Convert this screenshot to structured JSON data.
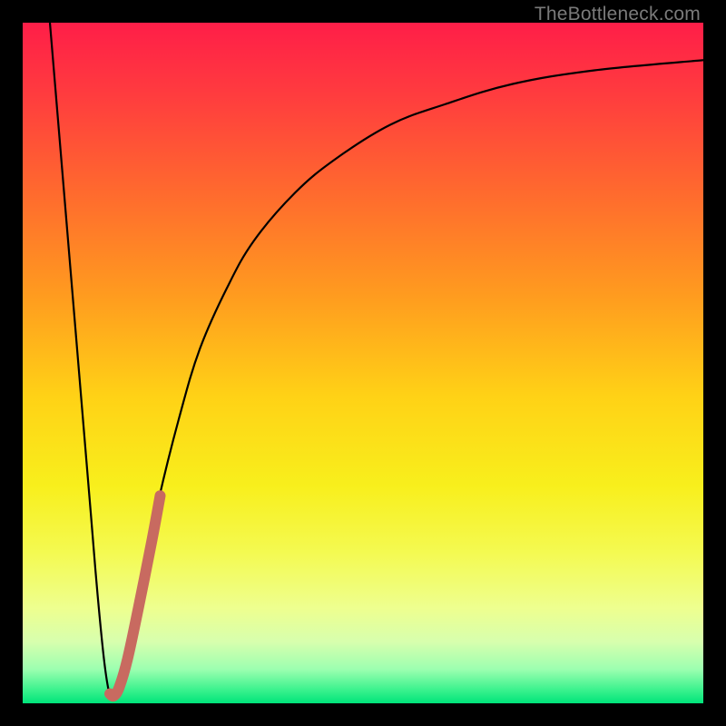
{
  "watermark": "TheBottleneck.com",
  "chart_data": {
    "type": "line",
    "title": "",
    "xlabel": "",
    "ylabel": "",
    "xlim": [
      0,
      100
    ],
    "ylim": [
      0,
      100
    ],
    "grid": false,
    "legend": false,
    "background_gradient": {
      "stops": [
        {
          "offset": 0.0,
          "color": "#ff1e48"
        },
        {
          "offset": 0.1,
          "color": "#ff3a3f"
        },
        {
          "offset": 0.25,
          "color": "#ff6a2e"
        },
        {
          "offset": 0.4,
          "color": "#ff9b1f"
        },
        {
          "offset": 0.55,
          "color": "#ffd216"
        },
        {
          "offset": 0.68,
          "color": "#f8ef1c"
        },
        {
          "offset": 0.78,
          "color": "#f4fa52"
        },
        {
          "offset": 0.86,
          "color": "#eeff8f"
        },
        {
          "offset": 0.91,
          "color": "#d7ffae"
        },
        {
          "offset": 0.95,
          "color": "#9cffb0"
        },
        {
          "offset": 0.98,
          "color": "#3cf28e"
        },
        {
          "offset": 1.0,
          "color": "#00e47a"
        }
      ]
    },
    "series": [
      {
        "name": "bottleneck-curve",
        "stroke": "#000000",
        "stroke_width": 2.2,
        "points": [
          {
            "x": 4.0,
            "y": 100.0
          },
          {
            "x": 5.0,
            "y": 88.0
          },
          {
            "x": 6.0,
            "y": 76.0
          },
          {
            "x": 7.0,
            "y": 64.0
          },
          {
            "x": 8.0,
            "y": 52.0
          },
          {
            "x": 9.0,
            "y": 40.0
          },
          {
            "x": 10.0,
            "y": 28.0
          },
          {
            "x": 11.0,
            "y": 16.0
          },
          {
            "x": 12.0,
            "y": 6.0
          },
          {
            "x": 12.8,
            "y": 1.2
          },
          {
            "x": 13.4,
            "y": 1.0
          },
          {
            "x": 14.5,
            "y": 3.5
          },
          {
            "x": 16.0,
            "y": 10.0
          },
          {
            "x": 18.0,
            "y": 20.0
          },
          {
            "x": 20.0,
            "y": 30.0
          },
          {
            "x": 23.0,
            "y": 42.0
          },
          {
            "x": 26.0,
            "y": 52.0
          },
          {
            "x": 30.0,
            "y": 61.0
          },
          {
            "x": 34.0,
            "y": 68.0
          },
          {
            "x": 40.0,
            "y": 75.0
          },
          {
            "x": 46.0,
            "y": 80.0
          },
          {
            "x": 54.0,
            "y": 85.0
          },
          {
            "x": 62.0,
            "y": 88.0
          },
          {
            "x": 72.0,
            "y": 91.0
          },
          {
            "x": 84.0,
            "y": 93.0
          },
          {
            "x": 100.0,
            "y": 94.5
          }
        ]
      },
      {
        "name": "highlight-segment",
        "stroke": "#c86a60",
        "stroke_width": 12,
        "linecap": "round",
        "points": [
          {
            "x": 12.8,
            "y": 1.4
          },
          {
            "x": 13.4,
            "y": 1.1
          },
          {
            "x": 14.2,
            "y": 2.4
          },
          {
            "x": 15.4,
            "y": 6.5
          },
          {
            "x": 17.0,
            "y": 14.0
          },
          {
            "x": 19.0,
            "y": 24.0
          },
          {
            "x": 20.2,
            "y": 30.5
          }
        ]
      }
    ]
  }
}
